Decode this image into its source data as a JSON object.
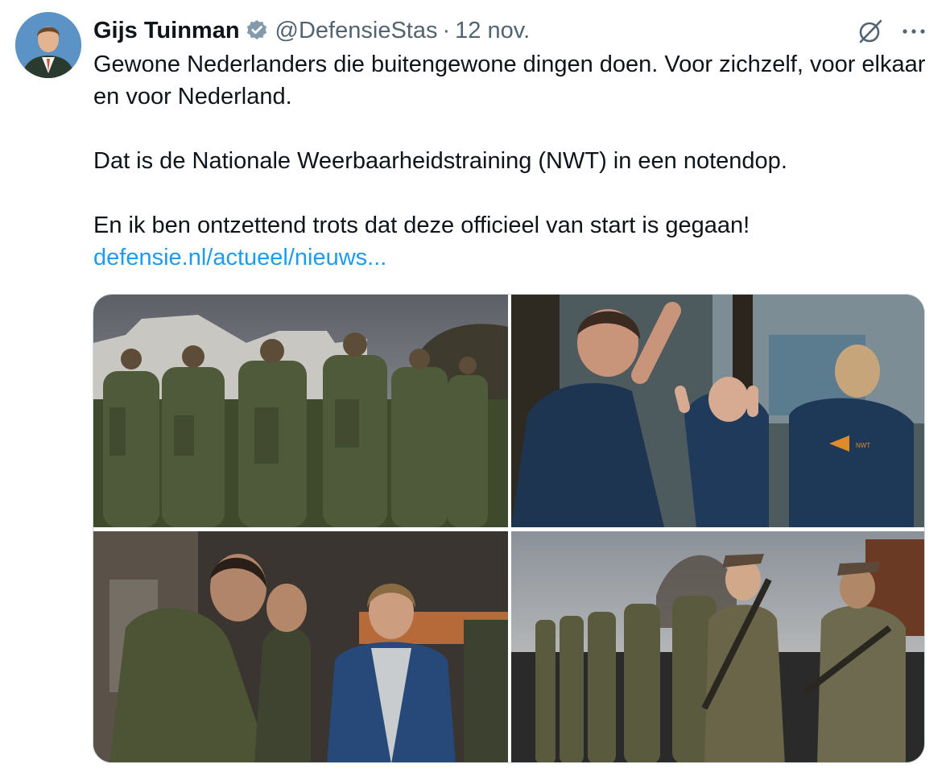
{
  "tweet": {
    "author_name": "Gijs Tuinman",
    "handle": "@DefensieStas",
    "separator": "·",
    "date": "12 nov.",
    "paragraph_1": "Gewone Nederlanders die buitengewone dingen doen. Voor zichzelf, voor elkaar en voor Nederland.",
    "paragraph_2": "Dat is de Nationale Weerbaarheidstraining (NWT) in een notendop.",
    "paragraph_3": "En ik ben ontzettend trots dat deze officieel van start is gegaan!",
    "link_text": "defensie.nl/actueel/nieuws..."
  },
  "icons": {
    "verified": "verified-badge-icon",
    "grok": "grok-icon",
    "more": "more-options-icon"
  },
  "media": {
    "count": 4,
    "photos": [
      {
        "name": "soldiers-lined-up-photo"
      },
      {
        "name": "high-five-training-photo"
      },
      {
        "name": "minister-with-recruits-photo"
      },
      {
        "name": "soldiers-with-rifles-photo"
      }
    ]
  },
  "colors": {
    "link": "#1d9bf0",
    "text": "#0f1419",
    "muted": "#536471",
    "border": "#cfd9de"
  }
}
